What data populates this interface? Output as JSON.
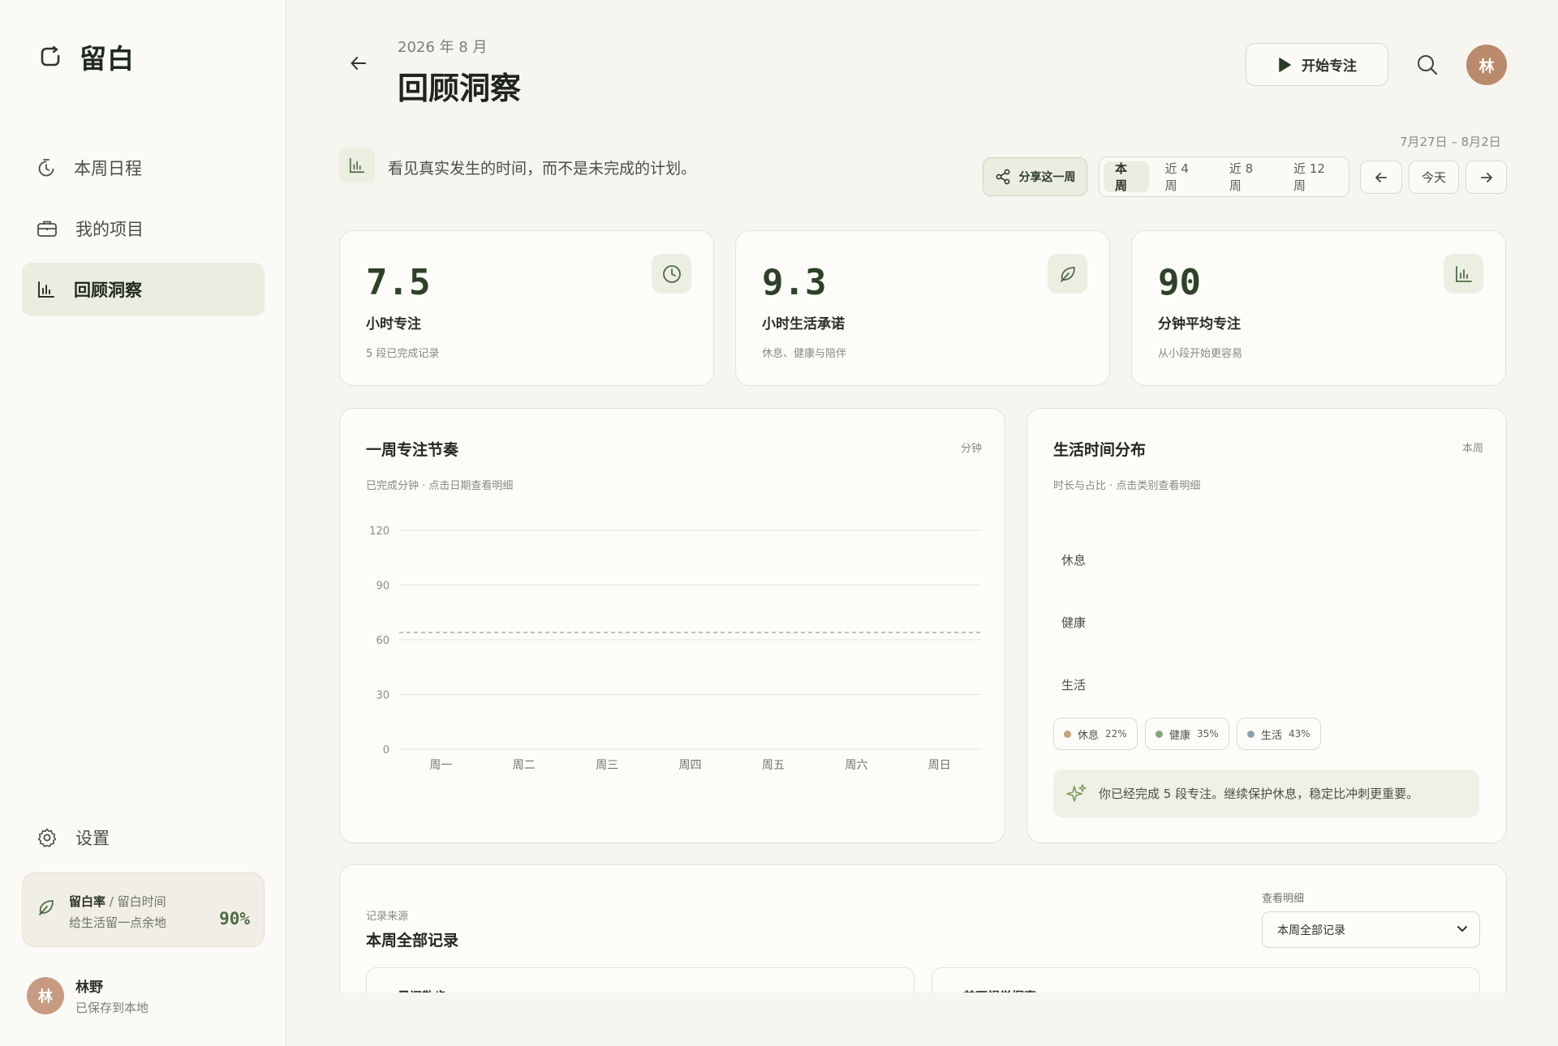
{
  "app": {
    "name": "留白"
  },
  "sidebar": {
    "items": [
      {
        "label": "本周日程",
        "icon": "timer-icon"
      },
      {
        "label": "我的项目",
        "icon": "briefcase-icon"
      },
      {
        "label": "回顾洞察",
        "icon": "bar-chart-icon",
        "active": true
      }
    ],
    "settings_label": "设置",
    "ratio": {
      "title": "留白率",
      "sep": "/",
      "title2": "留白时间",
      "desc": "给生活留一点余地",
      "value": "90%"
    },
    "user": {
      "initial": "林",
      "name": "林野",
      "status": "已保存到本地"
    }
  },
  "header": {
    "date": "2026 年 8 月",
    "title": "回顾洞察",
    "start_label": "开始专注",
    "avatar": "林",
    "range": "7月27日 – 8月2日"
  },
  "toolbar": {
    "tagline": "看见真实发生的时间，而不是未完成的计划。",
    "share_label": "分享这一周",
    "segments": [
      "本周",
      "近 4 周",
      "近 8 周",
      "近 12 周"
    ],
    "active_segment": "本周",
    "today_label": "今天"
  },
  "stats": [
    {
      "value": "7.5",
      "label": "小时专注",
      "sub": "5 段已完成记录",
      "icon": "clock-icon"
    },
    {
      "value": "9.3",
      "label": "小时生活承诺",
      "sub": "休息、健康与陪伴",
      "icon": "leaf-icon"
    },
    {
      "value": "90",
      "label": "分钟平均专注",
      "sub": "从小段开始更容易",
      "icon": "bar-chart-icon"
    }
  ],
  "rhythm": {
    "title": "一周专注节奏",
    "unit": "分钟",
    "subtitle": "已完成分钟 · 点击日期查看明细"
  },
  "chart_data": {
    "type": "bar",
    "categories": [
      "周一",
      "周二",
      "周三",
      "周四",
      "周五",
      "周六",
      "周日"
    ],
    "values": [
      0,
      0,
      0,
      0,
      0,
      0,
      0
    ],
    "average": 64,
    "ylim": [
      0,
      120
    ],
    "yticks": [
      "0",
      "30",
      "60",
      "90",
      "120"
    ],
    "grid": true
  },
  "distribution": {
    "title": "生活时间分布",
    "corner": "本周",
    "subtitle": "时长与占比 · 点击类别查看明细",
    "rows": [
      "休息",
      "健康",
      "生活"
    ],
    "chips": [
      {
        "label": "休息",
        "pct": "22%",
        "color": "#c3a27f"
      },
      {
        "label": "健康",
        "pct": "35%",
        "color": "#8aa57a"
      },
      {
        "label": "生活",
        "pct": "43%",
        "color": "#8da0ae"
      }
    ],
    "insight": "你已经完成 5 段专注。继续保护休息，稳定比冲刺更重要。"
  },
  "records": {
    "source": "记录来源",
    "title": "本周全部记录",
    "filter_label": "查看明细",
    "filter_value": "本周全部记录",
    "cards": [
      "晨间散步",
      "首页视觉探索"
    ]
  }
}
